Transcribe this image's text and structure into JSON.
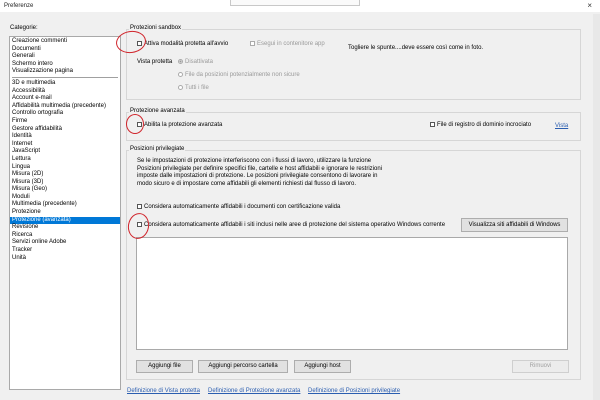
{
  "window": {
    "title": "Preferenze",
    "close_glyph": "×"
  },
  "categories_label": "Categorie:",
  "categories": [
    "Creazione commenti",
    "Documenti",
    "Generali",
    "Schermo intero",
    "Visualizzazione pagina",
    "---",
    "3D e multimedia",
    "Accessibilità",
    "Account e-mail",
    "Affidabilità multimedia (precedente)",
    "Controllo ortografia",
    "Firme",
    "Gestore affidabilità",
    "Identità",
    "Internet",
    "JavaScript",
    "Lettura",
    "Lingua",
    "Misura (2D)",
    "Misura (3D)",
    "Misura (Geo)",
    "Moduli",
    "Multimedia (precedente)",
    "Protezione",
    "Protezione (avanzata)",
    "Revisione",
    "Ricerca",
    "Servizi online Adobe",
    "Tracker",
    "Unità"
  ],
  "selected_category": "Protezione (avanzata)",
  "sandbox": {
    "title": "Protezioni sandbox",
    "protected_mode_label": "Attiva modalità protetta all'avvio",
    "container_label": "Esegui in contenitore app",
    "note": "Togliere le spunte....deve essere così come in foto.",
    "view_label": "Vista protetta",
    "options": [
      "Disattivata",
      "File da posizioni potenzialmente non sicure",
      "Tutti i file"
    ],
    "selected_option": "Disattivata"
  },
  "advanced": {
    "title": "Protezione avanzata",
    "enable_label": "Abilita la protezione avanzata",
    "log_label": "File di registro di dominio incrociato",
    "view_link": "Vista"
  },
  "privileged": {
    "title": "Posizioni privilegiate",
    "description": "Se le impostazioni di protezione interferiscono con i flussi di lavoro, utilizzare la funzione Posizioni privilegiate per definire specifici file, cartelle e host affidabili e ignorare le restrizioni imposte dalle impostazioni di protezione. Le posizioni privilegiate consentono di lavorare in modo sicuro e di impostare come affidabili gli elementi richiesti dal flusso di lavoro.",
    "cert_label": "Considera automaticamente affidabili i documenti con certificazione valida",
    "windows_zone_label": "Considera automaticamente affidabili i siti inclusi nelle aree di protezione del sistema operativo Windows corrente",
    "view_sites_button": "Visualizza siti affidabili di Windows",
    "add_file_button": "Aggiungi file",
    "add_folder_button": "Aggiungi percorso cartella",
    "add_host_button": "Aggiungi host",
    "remove_button": "Rimuovi"
  },
  "footer_links": [
    "Definizione di Vista protetta",
    "Definizione di Protezione avanzata",
    "Definizione di Posizioni privilegiate"
  ],
  "colors": {
    "selection": "#0078d7",
    "annotation_red": "#d0242b",
    "link": "#2a5db0"
  }
}
